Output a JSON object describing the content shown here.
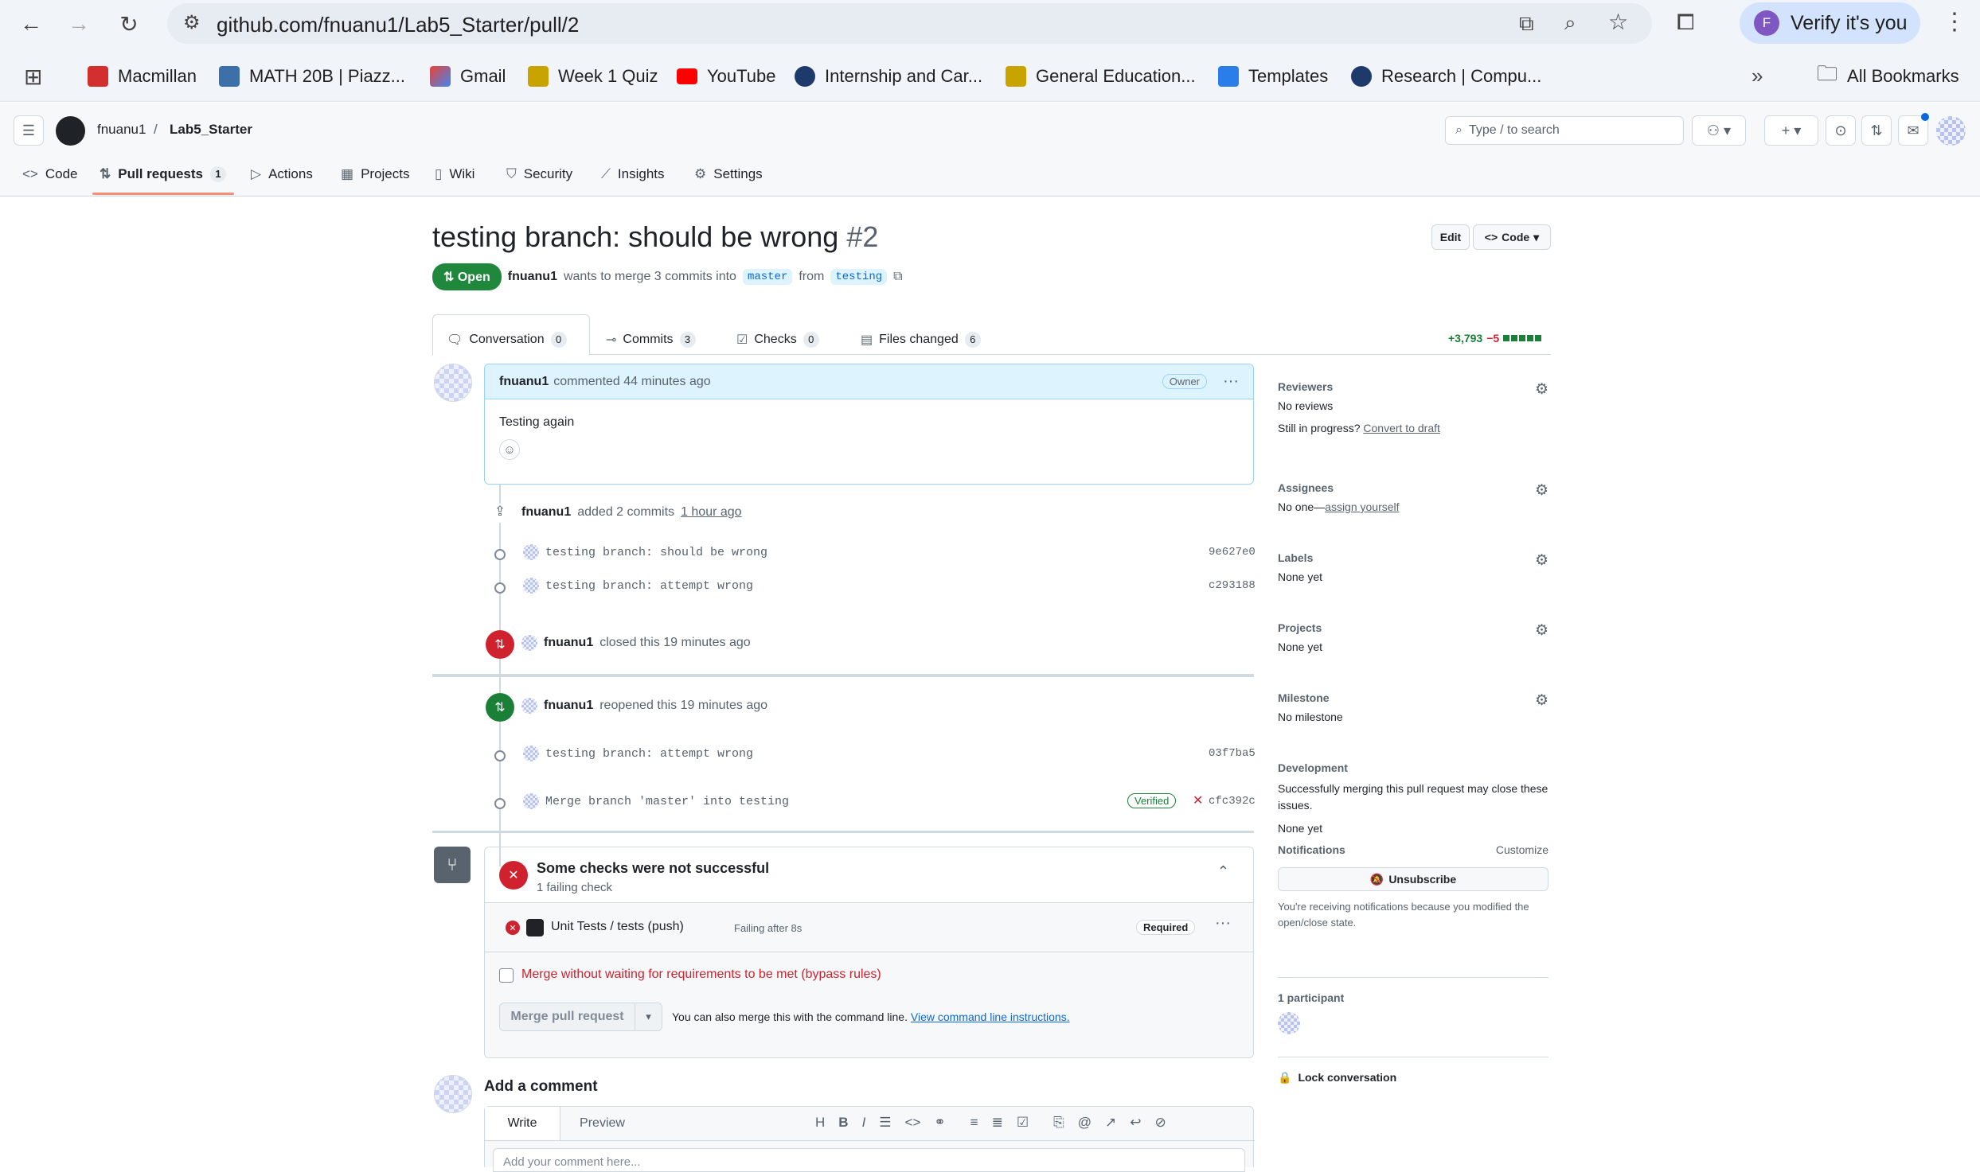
{
  "browser": {
    "url": "github.com/fnuanu1/Lab5_Starter/pull/2",
    "verify_label": "Verify it's you",
    "verify_avatar_letter": "F",
    "bookmarks": [
      "Macmillan",
      "MATH 20B | Piazz...",
      "Gmail",
      "Week 1 Quiz",
      "YouTube",
      "Internship and Car...",
      "General Education...",
      "Templates",
      "Research | Compu..."
    ],
    "all_bookmarks": "All Bookmarks"
  },
  "repo": {
    "owner": "fnuanu1",
    "separator": "/",
    "name": "Lab5_Starter",
    "search_placeholder": "Type / to search"
  },
  "repo_tabs": [
    {
      "label": "Code"
    },
    {
      "label": "Pull requests",
      "count": "1"
    },
    {
      "label": "Actions"
    },
    {
      "label": "Projects"
    },
    {
      "label": "Wiki"
    },
    {
      "label": "Security"
    },
    {
      "label": "Insights"
    },
    {
      "label": "Settings"
    }
  ],
  "pr": {
    "title": "testing branch: should be wrong",
    "number": "#2",
    "state": "Open",
    "author": "fnuanu1",
    "merge_text": "wants to merge 3 commits into",
    "base": "master",
    "from": "from",
    "head": "testing",
    "edit_label": "Edit",
    "code_label": "Code",
    "tabs": [
      {
        "label": "Conversation",
        "count": "0"
      },
      {
        "label": "Commits",
        "count": "3"
      },
      {
        "label": "Checks",
        "count": "0"
      },
      {
        "label": "Files changed",
        "count": "6"
      }
    ],
    "diff_add": "+3,793",
    "diff_del": "−5"
  },
  "comment": {
    "author": "fnuanu1",
    "meta": "commented 44 minutes ago",
    "role": "Owner",
    "body": "Testing again"
  },
  "timeline": {
    "added": {
      "author": "fnuanu1",
      "text": "added 2 commits",
      "time": "1 hour ago"
    },
    "commits1": [
      {
        "msg": "testing branch: should be wrong",
        "sha": "9e627e0"
      },
      {
        "msg": "testing branch: attempt wrong",
        "sha": "c293188"
      }
    ],
    "closed": {
      "author": "fnuanu1",
      "text": "closed this 19 minutes ago"
    },
    "reopened": {
      "author": "fnuanu1",
      "text": "reopened this 19 minutes ago"
    },
    "commits2": [
      {
        "msg": "testing branch: attempt wrong",
        "sha": "03f7ba5"
      },
      {
        "msg": "Merge branch 'master' into testing",
        "sha": "cfc392c",
        "verified": "Verified"
      }
    ]
  },
  "checks": {
    "title": "Some checks were not successful",
    "subtitle": "1 failing check",
    "item_name": "Unit Tests / tests (push)",
    "item_status": "Failing after 8s",
    "required": "Required",
    "bypass": "Merge without waiting for requirements to be met (bypass rules)",
    "merge_button": "Merge pull request",
    "cli_text": "You can also merge this with the command line.",
    "cli_link": "View command line instructions."
  },
  "add_comment": {
    "title": "Add a comment",
    "write": "Write",
    "preview": "Preview",
    "placeholder": "Add your comment here..."
  },
  "sidebar": {
    "reviewers": {
      "title": "Reviewers",
      "value": "No reviews",
      "progress": "Still in progress?",
      "draft_link": "Convert to draft"
    },
    "assignees": {
      "title": "Assignees",
      "value": "No one—",
      "link": "assign yourself"
    },
    "labels": {
      "title": "Labels",
      "value": "None yet"
    },
    "projects": {
      "title": "Projects",
      "value": "None yet"
    },
    "milestone": {
      "title": "Milestone",
      "value": "No milestone"
    },
    "development": {
      "title": "Development",
      "text": "Successfully merging this pull request may close these issues.",
      "value": "None yet"
    },
    "notifications": {
      "title": "Notifications",
      "customize": "Customize",
      "unsubscribe": "Unsubscribe",
      "reason": "You're receiving notifications because you modified the open/close state."
    },
    "participants": "1 participant",
    "lock": "Lock conversation"
  }
}
